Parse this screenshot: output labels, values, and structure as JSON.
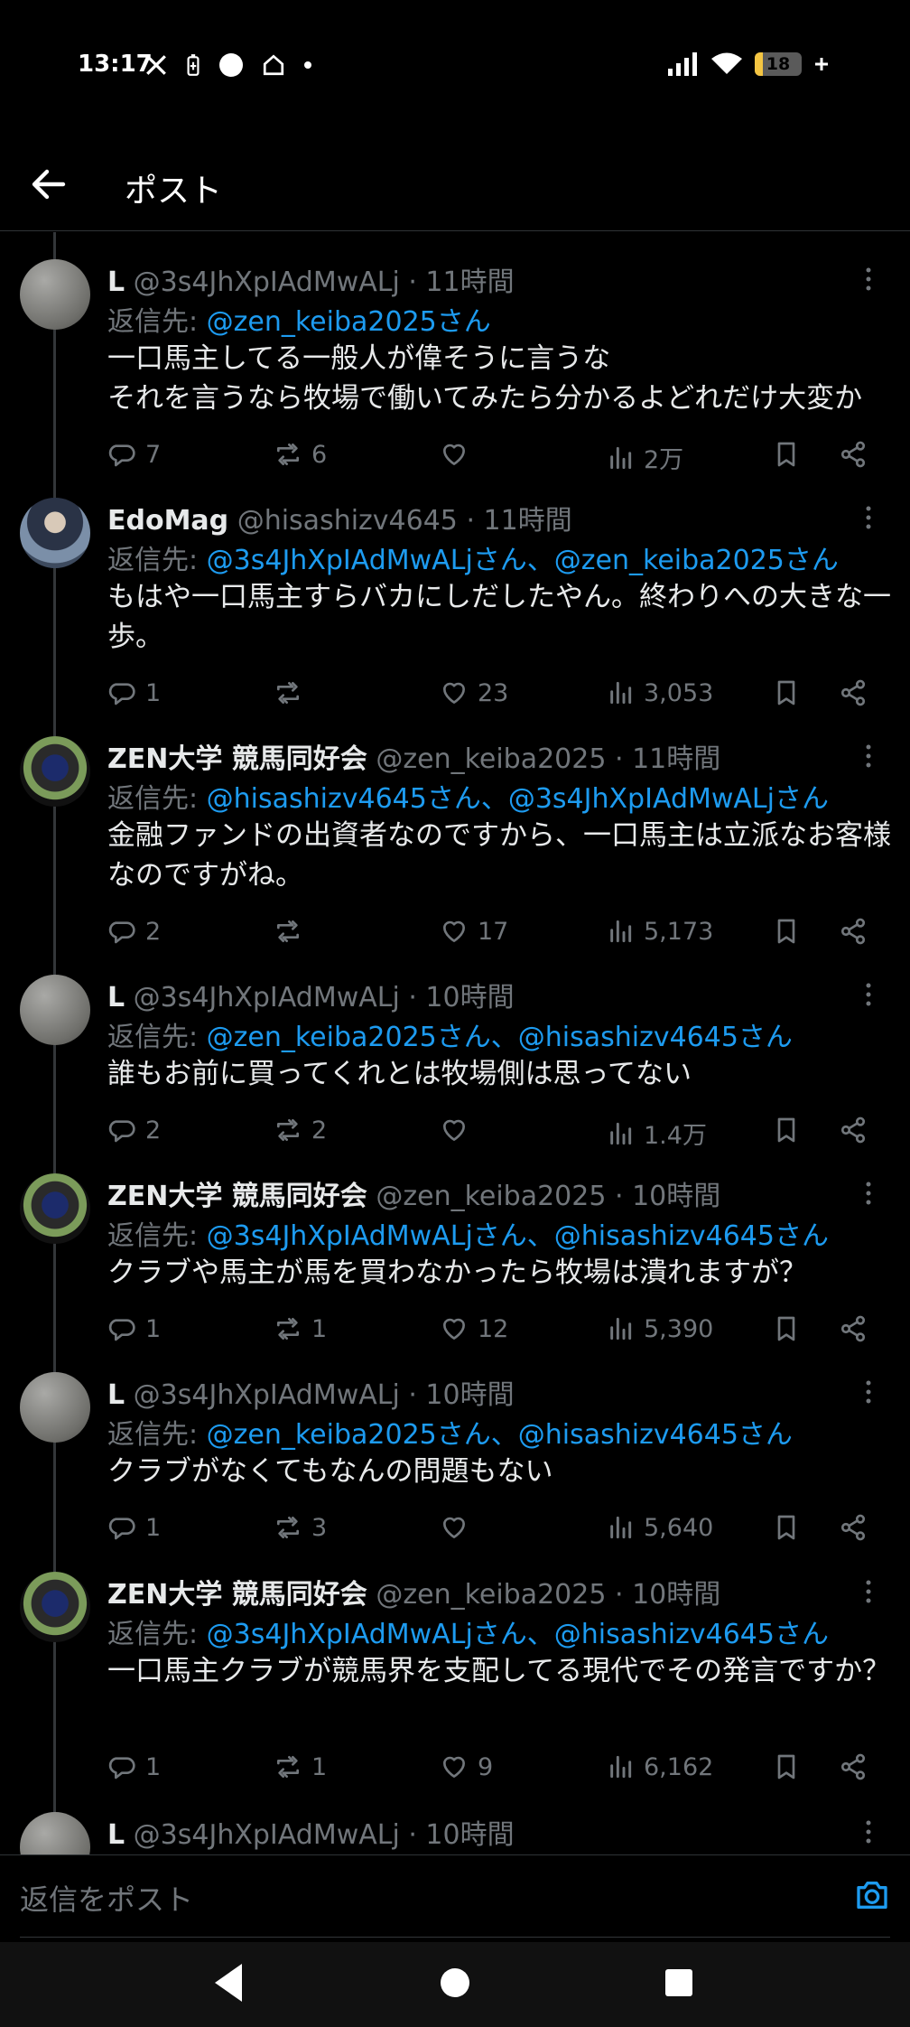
{
  "status": {
    "time": "13:17",
    "battery": "18",
    "battery_level": 0.18
  },
  "header": {
    "title": "ポスト"
  },
  "reply_prefix": "返信先: ",
  "tweets": [
    {
      "name": "L",
      "handle": "@3s4JhXpIAdMwALj",
      "time": "· 11時間",
      "reply_mentions": "@zen_keiba2025さん",
      "text": "一口馬主してる一般人が偉そうに言うな\nそれを言うなら牧場で働いてみたら分かるよどれだけ大変か",
      "replies": "7",
      "retweets": "6",
      "likes": "",
      "views": "2万",
      "avatar": "gray"
    },
    {
      "name": "EdoMag",
      "handle": "@hisashizv4645",
      "time": "· 11時間",
      "reply_mentions": "@3s4JhXpIAdMwALjさん、@zen_keiba2025さん",
      "text": "もはや一口馬主すらバカにしだしたやん。終わりへの大きな一歩。",
      "replies": "1",
      "retweets": "",
      "likes": "23",
      "views": "3,053",
      "avatar": "edo"
    },
    {
      "name": "ZEN大学 競馬同好会",
      "handle": "@zen_keiba2025",
      "time": "· 11時間",
      "reply_mentions": "@hisashizv4645さん、@3s4JhXpIAdMwALjさん",
      "text": "金融ファンドの出資者なのですから、一口馬主は立派なお客様なのですがね。",
      "replies": "2",
      "retweets": "",
      "likes": "17",
      "views": "5,173",
      "avatar": "zen"
    },
    {
      "name": "L",
      "handle": "@3s4JhXpIAdMwALj",
      "time": "· 10時間",
      "reply_mentions": "@zen_keiba2025さん、@hisashizv4645さん",
      "text": "誰もお前に買ってくれとは牧場側は思ってない",
      "replies": "2",
      "retweets": "2",
      "likes": "",
      "views": "1.4万",
      "avatar": "gray"
    },
    {
      "name": "ZEN大学 競馬同好会",
      "handle": "@zen_keiba2025",
      "time": "· 10時間",
      "reply_mentions": "@3s4JhXpIAdMwALjさん、@hisashizv4645さん",
      "text": "クラブや馬主が馬を買わなかったら牧場は潰れますが？",
      "replies": "1",
      "retweets": "1",
      "likes": "12",
      "views": "5,390",
      "avatar": "zen"
    },
    {
      "name": "L",
      "handle": "@3s4JhXpIAdMwALj",
      "time": "· 10時間",
      "reply_mentions": "@zen_keiba2025さん、@hisashizv4645さん",
      "text": "クラブがなくてもなんの問題もない",
      "replies": "1",
      "retweets": "3",
      "likes": "",
      "views": "5,640",
      "avatar": "gray"
    },
    {
      "name": "ZEN大学 競馬同好会",
      "handle": "@zen_keiba2025",
      "time": "· 10時間",
      "reply_mentions": "@3s4JhXpIAdMwALjさん、@hisashizv4645さん",
      "text": "一口馬主クラブが競馬界を支配してる現代でその発言ですか？",
      "replies": "1",
      "retweets": "1",
      "likes": "9",
      "views": "6,162",
      "avatar": "zen"
    },
    {
      "name": "L",
      "handle": "@3s4JhXpIAdMwALj",
      "time": "· 10時間",
      "reply_mentions": "",
      "text": "",
      "replies": "",
      "retweets": "",
      "likes": "",
      "views": "",
      "avatar": "gray"
    }
  ],
  "compose": {
    "placeholder": "返信をポスト"
  },
  "icons": {
    "back": "arrow-left-icon",
    "more": "more-vertical-icon",
    "reply": "reply-icon",
    "retweet": "retweet-icon",
    "like": "heart-icon",
    "views": "views-icon",
    "bookmark": "bookmark-icon",
    "share": "share-icon",
    "camera": "camera-icon"
  },
  "colors": {
    "background": "#000000",
    "link": "#1d9bf0",
    "muted": "#71767b",
    "text": "#e7e9ea"
  }
}
